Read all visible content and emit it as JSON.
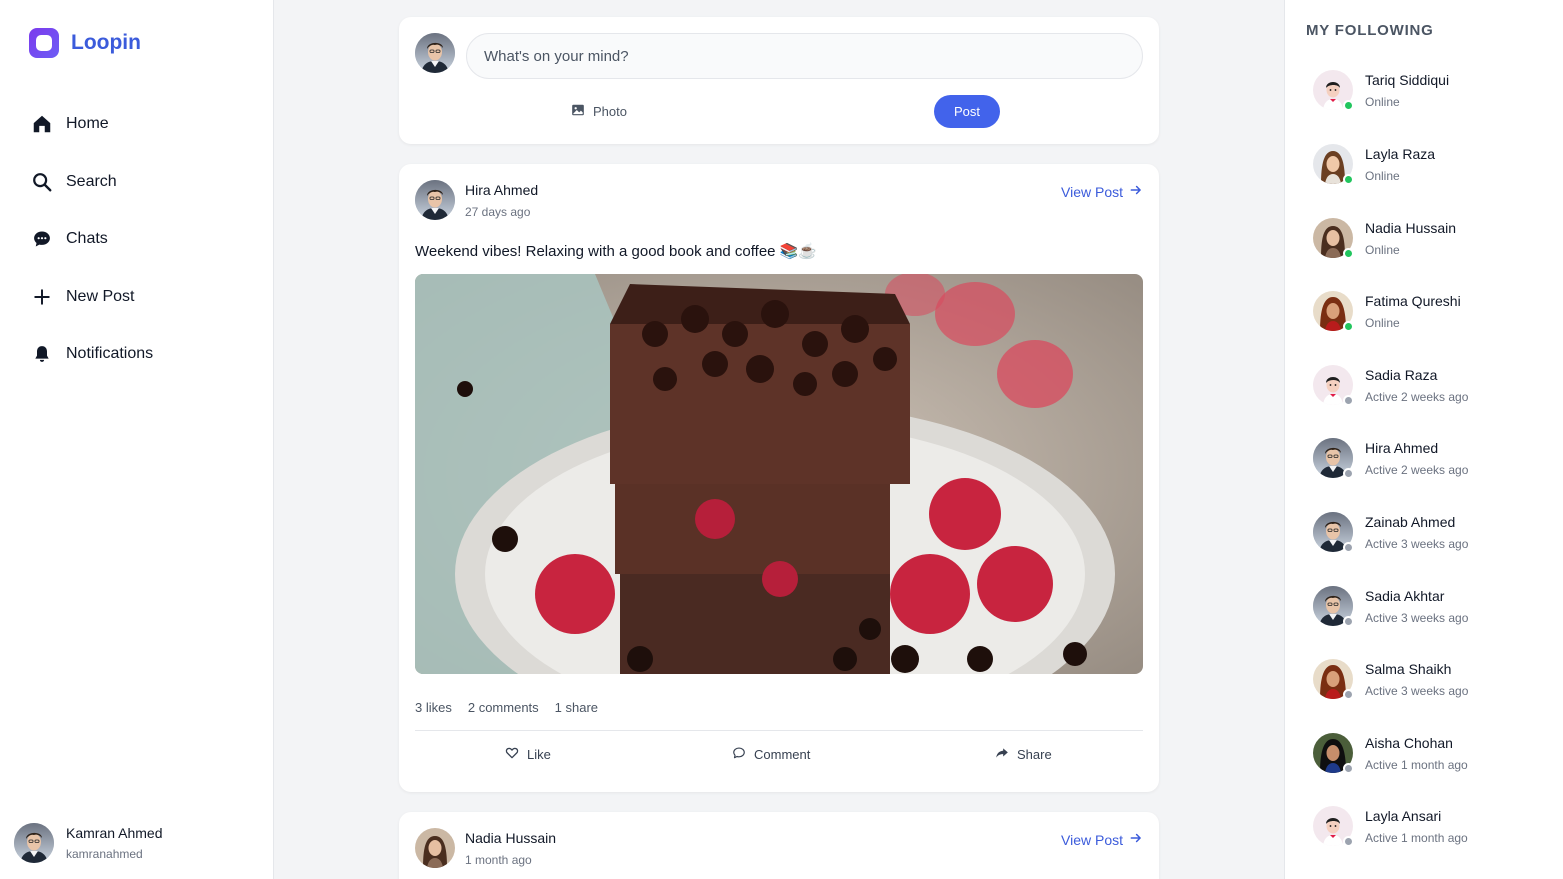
{
  "app": {
    "name": "Loopin",
    "accent": "#3b5bdb",
    "brand": "#7c3aed"
  },
  "nav": [
    {
      "label": "Home",
      "icon": "home-icon"
    },
    {
      "label": "Search",
      "icon": "search-icon"
    },
    {
      "label": "Chats",
      "icon": "chat-icon"
    },
    {
      "label": "New Post",
      "icon": "plus-icon"
    },
    {
      "label": "Notifications",
      "icon": "bell-icon"
    }
  ],
  "current_user": {
    "name": "Kamran Ahmed",
    "username": "kamranahmed"
  },
  "composer": {
    "placeholder": "What's on your mind?",
    "photo_label": "Photo",
    "post_label": "Post"
  },
  "posts": [
    {
      "author": "Hira Ahmed",
      "time": "27 days ago",
      "view_label": "View Post",
      "text": "Weekend vibes! Relaxing with a good book and coffee 📚☕",
      "likes": "3 likes",
      "comments": "2 comments",
      "shares": "1 share",
      "actions": {
        "like": "Like",
        "comment": "Comment",
        "share": "Share"
      }
    },
    {
      "author": "Nadia Hussain",
      "time": "1 month ago",
      "view_label": "View Post"
    }
  ],
  "following": {
    "title": "MY FOLLOWING",
    "online_color": "#22c55e",
    "offline_color": "#9ca3af",
    "people": [
      {
        "name": "Tariq Siddiqui",
        "status": "Online"
      },
      {
        "name": "Layla Raza",
        "status": "Online"
      },
      {
        "name": "Nadia Hussain",
        "status": "Online"
      },
      {
        "name": "Fatima Qureshi",
        "status": "Online"
      },
      {
        "name": "Sadia Raza",
        "status": "Active 2 weeks ago"
      },
      {
        "name": "Hira Ahmed",
        "status": "Active 2 weeks ago"
      },
      {
        "name": "Zainab Ahmed",
        "status": "Active 3 weeks ago"
      },
      {
        "name": "Sadia Akhtar",
        "status": "Active 3 weeks ago"
      },
      {
        "name": "Salma Shaikh",
        "status": "Active 3 weeks ago"
      },
      {
        "name": "Aisha Chohan",
        "status": "Active 1 month ago"
      },
      {
        "name": "Layla Ansari",
        "status": "Active 1 month ago"
      }
    ]
  }
}
